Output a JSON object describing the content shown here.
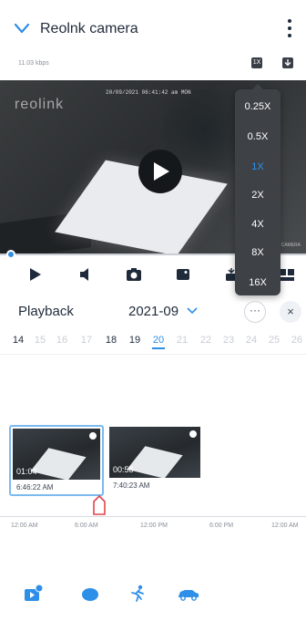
{
  "header": {
    "title": "Reolnk camera",
    "bitrate": "11.03 kbps",
    "icons": [
      "chevron-down-icon",
      "more-vert-icon",
      "fullscreen-icon",
      "download-icon"
    ],
    "hdr_label": "1X"
  },
  "video": {
    "logo": "reolink",
    "timestamp": "20/09/2021 06:41:42 am MON",
    "watermark": "CAMERA"
  },
  "speed_menu": {
    "options": [
      "0.25X",
      "0.5X",
      "1X",
      "2X",
      "4X",
      "8X",
      "16X"
    ],
    "selected": "1X"
  },
  "controls": [
    "play-icon",
    "volume-icon",
    "snapshot-icon",
    "record-icon",
    "speed-icon",
    "layout-icon"
  ],
  "playback": {
    "label": "Playback",
    "month": "2021-09",
    "more_label": "···",
    "close_label": "×"
  },
  "days": [
    {
      "label": "14",
      "state": "on"
    },
    {
      "label": "15",
      "state": "off"
    },
    {
      "label": "16",
      "state": "off"
    },
    {
      "label": "17",
      "state": "off"
    },
    {
      "label": "18",
      "state": "on"
    },
    {
      "label": "19",
      "state": "on"
    },
    {
      "label": "20",
      "state": "sel"
    },
    {
      "label": "21",
      "state": "off"
    },
    {
      "label": "22",
      "state": "off"
    },
    {
      "label": "23",
      "state": "off"
    },
    {
      "label": "24",
      "state": "off"
    },
    {
      "label": "25",
      "state": "off"
    },
    {
      "label": "26",
      "state": "off"
    }
  ],
  "clips": [
    {
      "duration": "01:04",
      "time": "6:46:22 AM",
      "selected": true
    },
    {
      "duration": "00:58",
      "time": "7:40:23 AM",
      "selected": false
    }
  ],
  "timeline": {
    "labels": [
      "12:00 AM",
      "6:00 AM",
      "12:00 PM",
      "6:00 PM",
      "12:00 AM"
    ]
  },
  "filters": [
    "video-alert-icon",
    "person-blob-icon",
    "running-person-icon",
    "vehicle-icon"
  ],
  "colors": {
    "accent": "#2e8fe8",
    "text": "#1f2a3a",
    "menu_bg": "#3e4247"
  }
}
